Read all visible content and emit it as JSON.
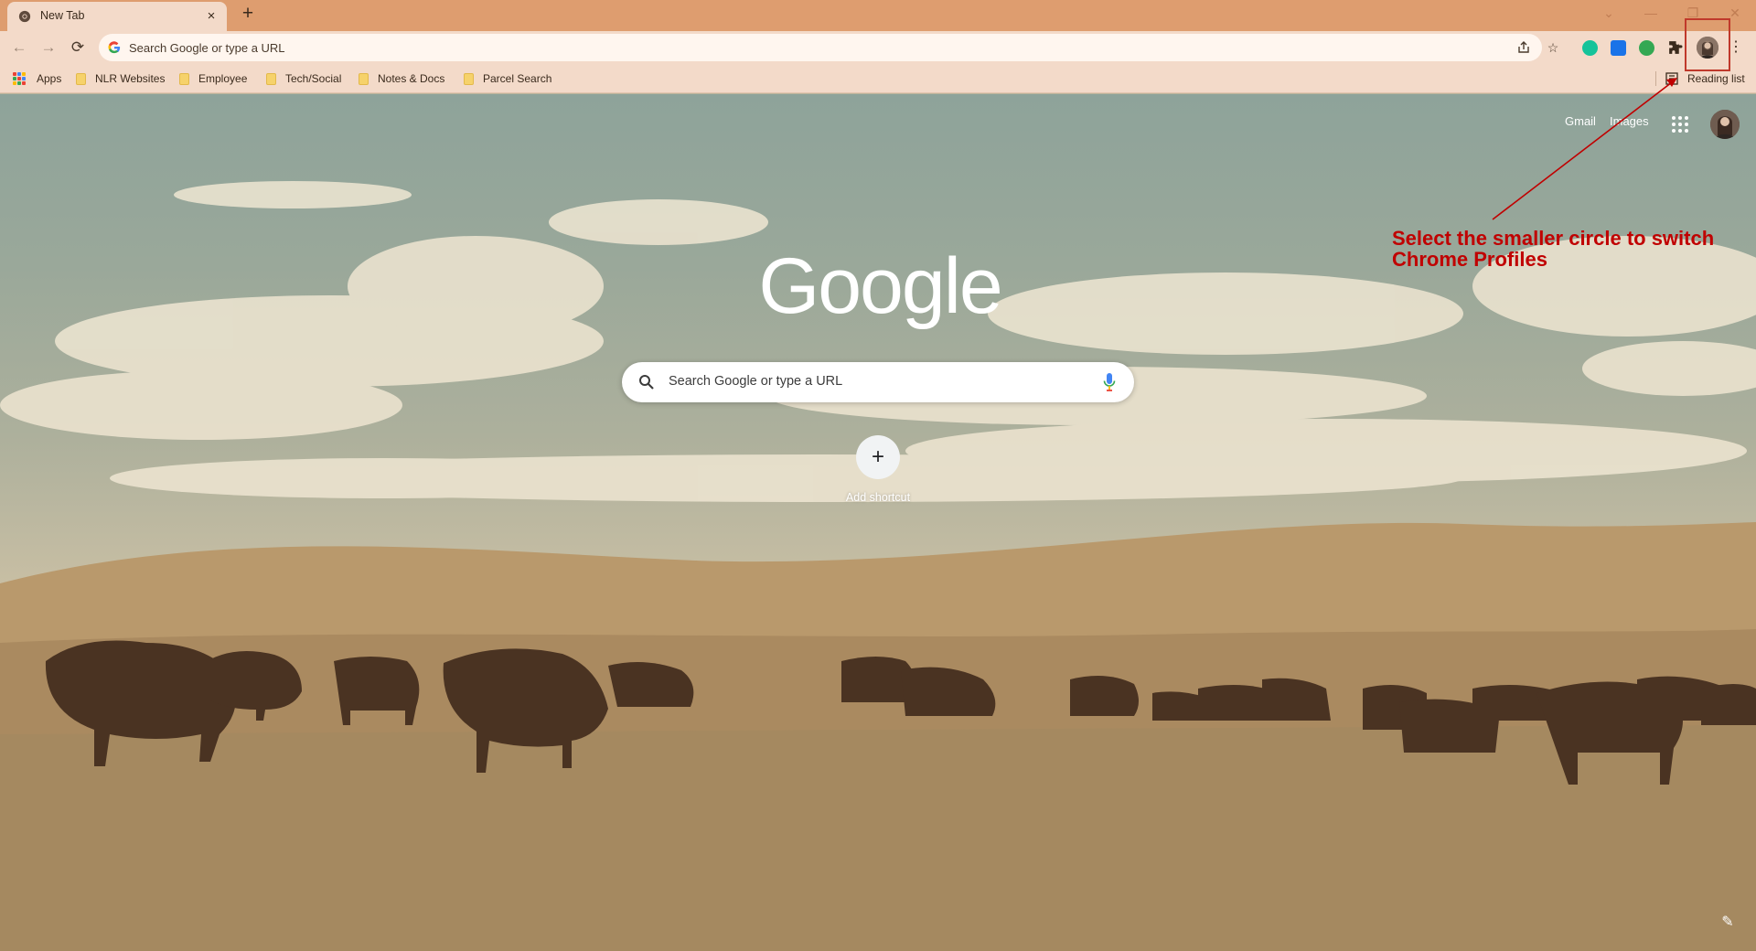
{
  "browser": {
    "tab": {
      "title": "New Tab",
      "close_glyph": "×"
    },
    "new_tab_glyph": "+",
    "window_controls": {
      "dropdown": "⌄",
      "minimize": "—",
      "restore": "❐",
      "close": "✕"
    },
    "omnibox": {
      "placeholder": "Search Google or type a URL"
    },
    "nav": {
      "back": "←",
      "forward": "→",
      "reload": "⟳"
    },
    "extensions": [
      {
        "name": "grammarly-icon",
        "color": "#15c39a"
      },
      {
        "name": "screen-capture-icon",
        "color": "#1a73e8"
      },
      {
        "name": "green-extension-icon",
        "color": "#34a853"
      }
    ],
    "menu_glyph": "⋮"
  },
  "bookmarks": {
    "apps_label": "Apps",
    "items": [
      {
        "label": "NLR Websites"
      },
      {
        "label": "Employee"
      },
      {
        "label": "Tech/Social"
      },
      {
        "label": "Notes & Docs"
      },
      {
        "label": "Parcel Search"
      }
    ],
    "reading_list": "Reading list"
  },
  "ntp": {
    "links": {
      "gmail": "Gmail",
      "images": "Images"
    },
    "logo_text": "Google",
    "search_placeholder": "Search Google or type a URL",
    "add_shortcut_glyph": "+",
    "add_shortcut_label": "Add shortcut",
    "customize_glyph": "✎"
  },
  "annotation": {
    "text": "Select the smaller circle to switch\nChrome Profiles",
    "color": "#c00000"
  }
}
